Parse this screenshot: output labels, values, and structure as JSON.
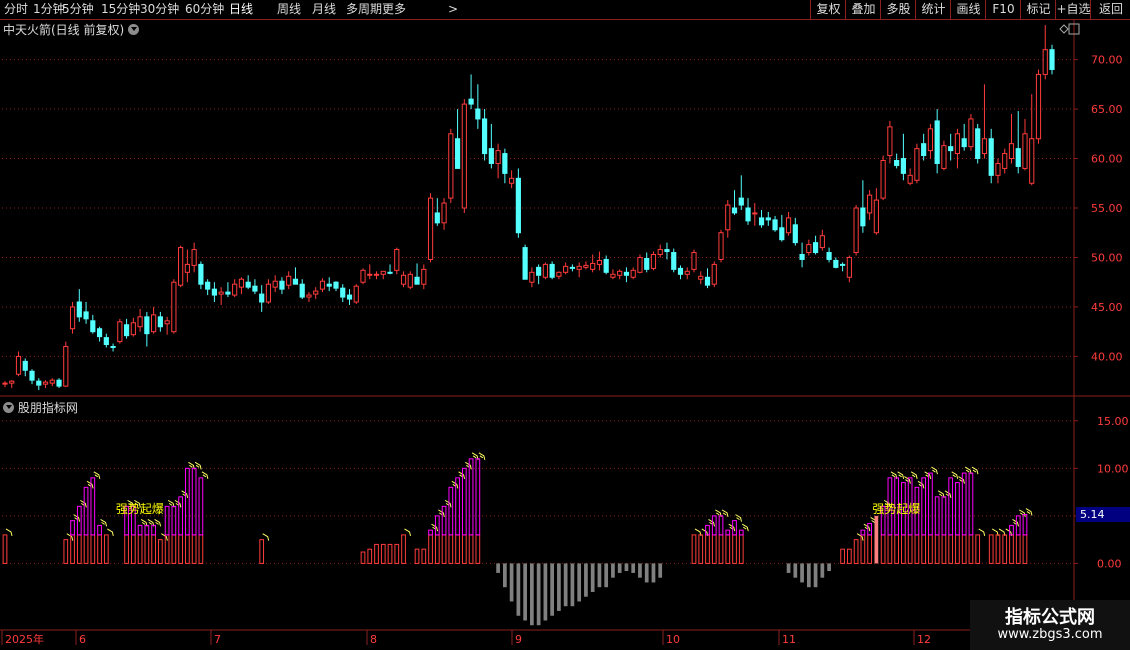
{
  "toolbar": {
    "left_items": [
      "分时",
      "1分钟",
      "5分钟",
      "15分钟",
      "30分钟",
      "60分钟",
      "日线",
      "周线",
      "月线",
      "多周期",
      "更多"
    ],
    "more_arrow": ">",
    "right_items": [
      "复权",
      "叠加",
      "多股",
      "统计",
      "画线",
      "F10",
      "+自选",
      "标记",
      "返回"
    ]
  },
  "main_chart": {
    "title": "中天火箭(日线 前复权)",
    "price_axis": [
      "70.00",
      "65.00",
      "60.00",
      "55.00",
      "50.00",
      "45.00",
      "40.00"
    ]
  },
  "indicator": {
    "title": "股朋指标网",
    "axis": [
      "15.00",
      "10.00",
      "5.00",
      "0.00"
    ],
    "current_value": "5.14",
    "signal_label": "强势起爆"
  },
  "date_axis": [
    "2025年",
    "6",
    "7",
    "8",
    "9",
    "10",
    "11",
    "12"
  ],
  "watermark": {
    "title": "指标公式网",
    "url": "www.zbgs3.com"
  },
  "colors": {
    "up": "#ff3c3c",
    "down": "#54ffff",
    "grid": "#8a1f1f",
    "magenta": "#ff00ff",
    "gray": "#808080",
    "signal": "#ff8080",
    "label_yellow": "#ffff00"
  },
  "chart_data": {
    "type": "candlestick",
    "ohlc": [
      [
        37.3,
        37.5,
        36.9,
        37.3
      ],
      [
        37.3,
        37.6,
        36.8,
        37.5
      ],
      [
        38.2,
        40.5,
        38.0,
        40.0
      ],
      [
        39.5,
        39.8,
        38.0,
        38.6
      ],
      [
        38.5,
        38.7,
        37.2,
        37.6
      ],
      [
        37.5,
        37.8,
        36.6,
        37.1
      ],
      [
        37.2,
        37.6,
        36.8,
        37.4
      ],
      [
        37.3,
        37.8,
        37.0,
        37.6
      ],
      [
        37.6,
        37.8,
        36.8,
        37.0
      ],
      [
        37.0,
        41.5,
        36.9,
        41.0
      ],
      [
        42.8,
        45.5,
        42.3,
        45.0
      ],
      [
        45.5,
        46.8,
        43.5,
        44.0
      ],
      [
        44.5,
        45.5,
        43.3,
        43.8
      ],
      [
        43.6,
        44.2,
        42.3,
        42.5
      ],
      [
        42.8,
        43.0,
        41.5,
        42.0
      ],
      [
        41.9,
        42.3,
        40.9,
        41.2
      ],
      [
        41.0,
        41.3,
        40.5,
        40.9
      ],
      [
        41.5,
        43.8,
        41.3,
        43.5
      ],
      [
        43.2,
        43.8,
        41.8,
        42.1
      ],
      [
        42.2,
        43.9,
        42.0,
        43.4
      ],
      [
        43.0,
        44.8,
        42.5,
        44.0
      ],
      [
        44.0,
        44.5,
        41.0,
        42.3
      ],
      [
        42.5,
        45.0,
        42.3,
        44.2
      ],
      [
        44.0,
        44.5,
        42.5,
        43.0
      ],
      [
        43.3,
        44.0,
        42.2,
        43.6
      ],
      [
        42.5,
        47.8,
        42.3,
        47.5
      ],
      [
        47.2,
        51.2,
        47.0,
        51.0
      ],
      [
        48.5,
        50.8,
        47.5,
        49.3
      ],
      [
        49.2,
        51.5,
        48.5,
        50.8
      ],
      [
        49.3,
        49.6,
        46.8,
        47.3
      ],
      [
        47.5,
        47.8,
        46.2,
        46.8
      ],
      [
        46.8,
        47.5,
        45.5,
        46.2
      ],
      [
        46.3,
        47.0,
        45.2,
        46.5
      ],
      [
        46.5,
        47.5,
        46.0,
        46.3
      ],
      [
        46.2,
        47.8,
        46.0,
        47.3
      ],
      [
        47.0,
        48.0,
        46.3,
        47.8
      ],
      [
        47.5,
        48.2,
        46.8,
        47.0
      ],
      [
        47.1,
        47.8,
        46.3,
        46.6
      ],
      [
        46.3,
        47.2,
        44.5,
        45.5
      ],
      [
        45.5,
        47.8,
        45.3,
        47.3
      ],
      [
        47.0,
        48.2,
        46.5,
        47.6
      ],
      [
        47.6,
        48.0,
        46.3,
        46.8
      ],
      [
        47.2,
        48.6,
        46.8,
        48.1
      ],
      [
        47.8,
        49.0,
        47.3,
        47.3
      ],
      [
        47.3,
        47.8,
        45.8,
        46.0
      ],
      [
        46.0,
        46.5,
        45.5,
        46.2
      ],
      [
        46.3,
        47.0,
        45.8,
        46.6
      ],
      [
        46.8,
        47.9,
        46.5,
        47.6
      ],
      [
        47.3,
        48.0,
        46.6,
        47.1
      ],
      [
        47.5,
        47.6,
        46.6,
        46.9
      ],
      [
        46.9,
        47.3,
        45.5,
        46.0
      ],
      [
        46.2,
        46.8,
        45.2,
        45.8
      ],
      [
        45.5,
        47.3,
        45.3,
        47.1
      ],
      [
        47.5,
        48.9,
        47.3,
        48.7
      ],
      [
        48.2,
        49.3,
        47.8,
        48.3
      ],
      [
        48.2,
        48.6,
        47.8,
        48.3
      ],
      [
        48.3,
        48.6,
        47.8,
        48.6
      ],
      [
        48.5,
        49.3,
        48.3,
        48.4
      ],
      [
        48.7,
        51.0,
        48.3,
        50.8
      ],
      [
        47.3,
        48.6,
        47.0,
        48.2
      ],
      [
        47.0,
        48.6,
        46.8,
        48.3
      ],
      [
        48.0,
        49.4,
        47.3,
        47.3
      ],
      [
        47.3,
        49.3,
        46.8,
        48.8
      ],
      [
        49.8,
        56.5,
        49.5,
        56.0
      ],
      [
        54.5,
        56.0,
        53.2,
        53.5
      ],
      [
        53.5,
        56.0,
        52.8,
        55.5
      ],
      [
        56.0,
        63.0,
        55.5,
        62.5
      ],
      [
        62.0,
        65.0,
        61.0,
        59.0
      ],
      [
        55.0,
        66.0,
        54.5,
        65.5
      ],
      [
        66.0,
        68.5,
        65.0,
        65.5
      ],
      [
        65.0,
        67.5,
        63.0,
        64.0
      ],
      [
        64.0,
        65.0,
        59.8,
        60.5
      ],
      [
        61.0,
        63.5,
        59.0,
        59.5
      ],
      [
        59.5,
        61.5,
        58.0,
        60.8
      ],
      [
        60.5,
        61.0,
        57.5,
        58.5
      ],
      [
        57.5,
        58.8,
        57.0,
        58.0
      ],
      [
        58.0,
        59.0,
        52.0,
        52.5
      ],
      [
        51.0,
        51.3,
        47.8,
        47.8
      ],
      [
        47.5,
        49.0,
        47.0,
        48.5
      ],
      [
        49.0,
        49.3,
        47.3,
        48.2
      ],
      [
        48.0,
        49.5,
        47.8,
        49.3
      ],
      [
        49.3,
        49.6,
        47.8,
        48.0
      ],
      [
        48.1,
        48.6,
        47.8,
        48.5
      ],
      [
        48.5,
        49.5,
        48.3,
        49.1
      ],
      [
        49.0,
        49.3,
        48.6,
        48.9
      ],
      [
        48.8,
        49.5,
        48.0,
        49.1
      ],
      [
        49.0,
        49.6,
        48.8,
        49.2
      ],
      [
        48.8,
        50.3,
        48.5,
        49.4
      ],
      [
        49.3,
        50.6,
        48.7,
        49.7
      ],
      [
        49.8,
        50.2,
        48.3,
        48.5
      ],
      [
        48.0,
        48.8,
        47.8,
        48.3
      ],
      [
        48.2,
        48.8,
        47.8,
        48.6
      ],
      [
        48.5,
        49.0,
        47.5,
        48.2
      ],
      [
        48.0,
        49.0,
        47.8,
        48.7
      ],
      [
        48.5,
        50.3,
        48.4,
        50.0
      ],
      [
        49.9,
        50.5,
        48.5,
        48.8
      ],
      [
        48.9,
        50.6,
        48.7,
        50.3
      ],
      [
        50.3,
        51.3,
        50.0,
        50.8
      ],
      [
        50.8,
        51.5,
        49.8,
        50.6
      ],
      [
        50.5,
        50.9,
        48.5,
        48.8
      ],
      [
        48.9,
        49.2,
        47.8,
        48.3
      ],
      [
        48.3,
        49.0,
        47.8,
        48.6
      ],
      [
        48.8,
        50.8,
        48.5,
        50.5
      ],
      [
        47.8,
        48.6,
        47.3,
        48.1
      ],
      [
        48.0,
        48.9,
        46.9,
        47.2
      ],
      [
        47.3,
        49.6,
        47.0,
        49.3
      ],
      [
        49.8,
        52.8,
        49.5,
        52.5
      ],
      [
        52.8,
        55.8,
        52.0,
        55.3
      ],
      [
        55.0,
        56.8,
        54.3,
        54.5
      ],
      [
        56.0,
        58.3,
        54.8,
        55.3
      ],
      [
        55.0,
        56.0,
        53.3,
        53.7
      ],
      [
        54.5,
        55.5,
        53.2,
        54.5
      ],
      [
        54.0,
        54.8,
        53.0,
        53.3
      ],
      [
        54.0,
        54.6,
        53.2,
        53.8
      ],
      [
        53.8,
        54.2,
        52.6,
        52.8
      ],
      [
        53.0,
        54.3,
        51.6,
        51.8
      ],
      [
        52.5,
        54.6,
        52.2,
        54.0
      ],
      [
        53.3,
        54.0,
        51.2,
        51.5
      ],
      [
        50.3,
        51.5,
        49.0,
        49.8
      ],
      [
        50.5,
        51.8,
        50.2,
        51.3
      ],
      [
        51.5,
        52.2,
        50.3,
        50.5
      ],
      [
        51.0,
        52.8,
        50.7,
        52.2
      ],
      [
        50.5,
        51.0,
        49.5,
        49.8
      ],
      [
        49.7,
        50.0,
        48.9,
        49.0
      ],
      [
        49.3,
        49.5,
        48.6,
        49.2
      ],
      [
        48.0,
        50.2,
        47.5,
        50.0
      ],
      [
        50.5,
        55.3,
        50.2,
        55.0
      ],
      [
        55.0,
        57.8,
        52.5,
        53.2
      ],
      [
        54.5,
        56.8,
        53.8,
        56.3
      ],
      [
        52.5,
        57.0,
        52.3,
        55.8
      ],
      [
        56.0,
        60.3,
        55.8,
        59.8
      ],
      [
        60.3,
        63.8,
        59.5,
        63.2
      ],
      [
        59.8,
        60.5,
        59.0,
        59.3
      ],
      [
        60.0,
        62.5,
        57.8,
        58.5
      ],
      [
        57.5,
        59.0,
        57.3,
        58.3
      ],
      [
        57.8,
        61.5,
        57.5,
        61.0
      ],
      [
        61.5,
        62.5,
        59.8,
        60.3
      ],
      [
        60.8,
        63.5,
        60.0,
        63.0
      ],
      [
        63.8,
        65.0,
        58.5,
        59.5
      ],
      [
        59.0,
        61.8,
        58.8,
        61.3
      ],
      [
        61.2,
        62.5,
        59.8,
        60.8
      ],
      [
        60.5,
        63.0,
        59.0,
        62.5
      ],
      [
        62.0,
        63.5,
        60.8,
        61.2
      ],
      [
        61.2,
        64.5,
        60.8,
        64.0
      ],
      [
        63.0,
        63.5,
        59.5,
        60.0
      ],
      [
        60.5,
        67.5,
        60.0,
        62.0
      ],
      [
        62.0,
        63.0,
        57.5,
        58.3
      ],
      [
        58.3,
        60.0,
        57.5,
        59.5
      ],
      [
        59.0,
        61.0,
        58.5,
        60.5
      ],
      [
        60.0,
        64.5,
        59.5,
        61.5
      ],
      [
        61.0,
        64.8,
        58.5,
        59.2
      ],
      [
        59.0,
        64.0,
        58.8,
        62.5
      ],
      [
        57.5,
        66.5,
        57.3,
        62.0
      ],
      [
        62.0,
        69.0,
        61.5,
        68.5
      ],
      [
        68.5,
        73.5,
        68.0,
        71.0
      ],
      [
        71.0,
        71.5,
        68.5,
        69.0
      ]
    ],
    "indicator_values": [
      3,
      0,
      0,
      0,
      0,
      0,
      0,
      0,
      0,
      2.5,
      4.5,
      6,
      8,
      9,
      4,
      3,
      0,
      0,
      6,
      6,
      4,
      4,
      4,
      2.5,
      6,
      6,
      7,
      10,
      10,
      9,
      0,
      0,
      0,
      0,
      0,
      0,
      0,
      0,
      2.5,
      0,
      0,
      0,
      0,
      0,
      0,
      0,
      0,
      0,
      0,
      0,
      0,
      0,
      0,
      1.2,
      1.5,
      2,
      2,
      2,
      2,
      3,
      0,
      1.5,
      1.5,
      3.5,
      5,
      6,
      8,
      9,
      10,
      11,
      11,
      0,
      0,
      -1,
      -2.5,
      -4,
      -5.5,
      -6,
      -6.5,
      -6.5,
      -6,
      -5.5,
      -5,
      -4.5,
      -4.5,
      -4,
      -3.5,
      -3,
      -2.5,
      -2.5,
      -1.5,
      -1,
      -0.8,
      -1,
      -1.5,
      -2,
      -2,
      -1.5,
      0,
      0,
      0,
      0,
      3,
      3,
      4,
      5,
      5,
      3.5,
      4.5,
      3.5,
      0,
      0,
      0,
      0,
      0,
      0,
      -1,
      -1.5,
      -2,
      -2.5,
      -2.5,
      -1.5,
      -0.8,
      0,
      1.5,
      1.5,
      2.5,
      3.5,
      4.2,
      5,
      6,
      9,
      9,
      8.5,
      9,
      8,
      9,
      9.5,
      7,
      7,
      9,
      8.5,
      9.5,
      9.5,
      3,
      0,
      3,
      3,
      3,
      4,
      5,
      5.14
    ],
    "price_range": [
      36.0,
      74.0
    ],
    "indicator_range": [
      -7.0,
      17.5
    ]
  }
}
